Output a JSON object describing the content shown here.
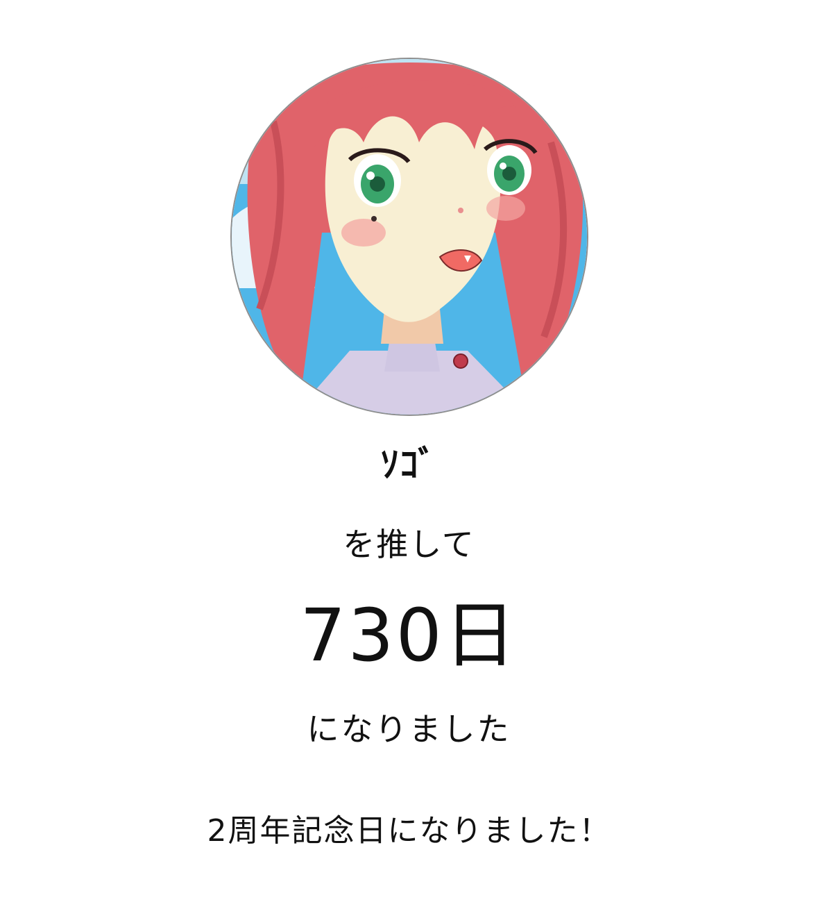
{
  "profile": {
    "avatar_icon": "anime-character-portrait",
    "name": "ｿｺﾞ"
  },
  "milestone": {
    "prefix": "を推して",
    "days": "730日",
    "suffix": "になりました",
    "message": "2周年記念日になりました！"
  },
  "colors": {
    "background": "#ffffff",
    "text": "#111111",
    "hair": "#e0636a",
    "eyes": "#3aa56b",
    "sky": "#4fb6e8"
  }
}
